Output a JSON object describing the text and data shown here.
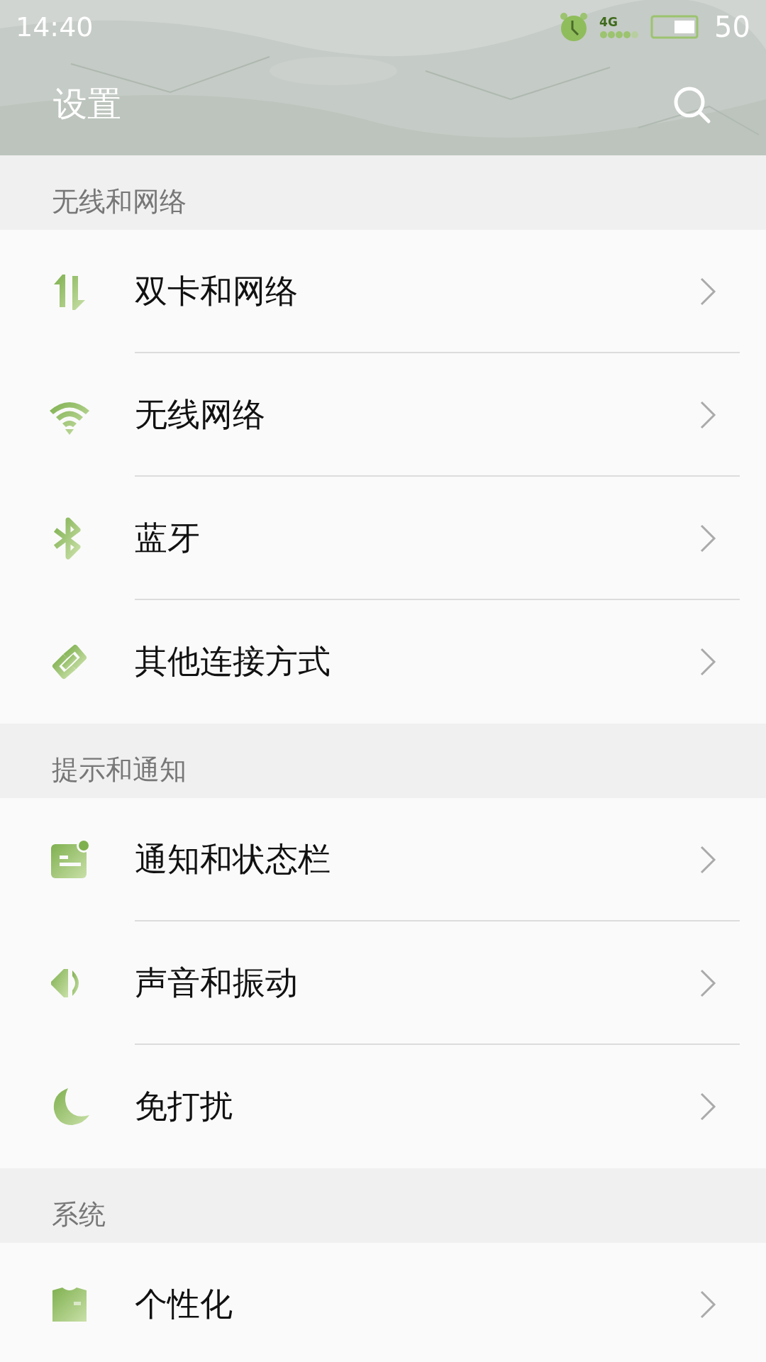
{
  "status_bar": {
    "time": "14:40",
    "network": "4G",
    "battery": "50"
  },
  "header": {
    "title": "设置"
  },
  "sections": [
    {
      "title": "无线和网络",
      "items": [
        {
          "label": "双卡和网络"
        },
        {
          "label": "无线网络"
        },
        {
          "label": "蓝牙"
        },
        {
          "label": "其他连接方式"
        }
      ]
    },
    {
      "title": "提示和通知",
      "items": [
        {
          "label": "通知和状态栏"
        },
        {
          "label": "声音和振动"
        },
        {
          "label": "免打扰"
        }
      ]
    },
    {
      "title": "系统",
      "items": [
        {
          "label": "个性化"
        }
      ]
    }
  ]
}
